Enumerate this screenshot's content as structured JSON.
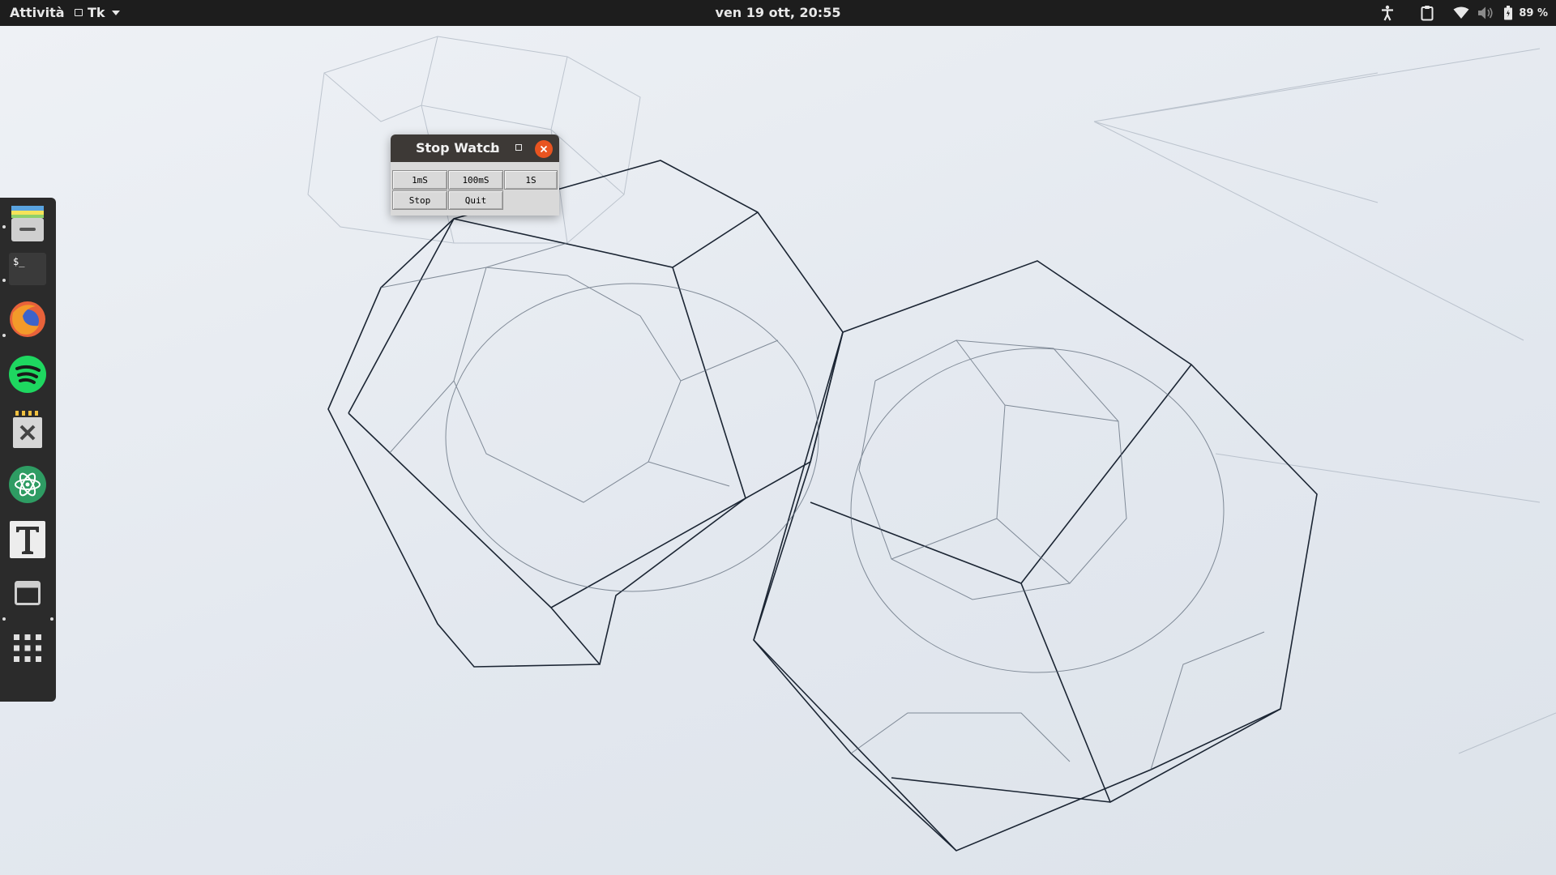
{
  "topbar": {
    "activities": "Attività",
    "app_menu": "Tk",
    "clock": "ven 19 ott, 20:55",
    "battery_percent": "89 %"
  },
  "dock": {
    "items": [
      {
        "name": "files",
        "icon": "files-icon",
        "running": true
      },
      {
        "name": "terminal",
        "icon": "terminal-icon",
        "running": true
      },
      {
        "name": "firefox",
        "icon": "firefox-icon",
        "running": true
      },
      {
        "name": "spotify",
        "icon": "spotify-icon",
        "running": false
      },
      {
        "name": "x-app",
        "icon": "x-app-icon",
        "running": false
      },
      {
        "name": "atom",
        "icon": "atom-icon",
        "running": false
      },
      {
        "name": "typora",
        "icon": "text-editor-icon",
        "running": false
      },
      {
        "name": "tk-window",
        "icon": "window-icon",
        "running": true
      },
      {
        "name": "show-applications",
        "icon": "app-grid-icon",
        "running": false
      }
    ]
  },
  "window": {
    "title": "Stop Watch",
    "buttons": {
      "ms1": "1mS",
      "ms100": "100mS",
      "s1": "1S",
      "stop": "Stop",
      "quit": "Quit"
    }
  },
  "colors": {
    "topbar": "#1d1d1d",
    "dock": "#2b2b2b",
    "close_button": "#e95420",
    "tk_background": "#d9d9d9",
    "titlebar": "#3d3936"
  }
}
